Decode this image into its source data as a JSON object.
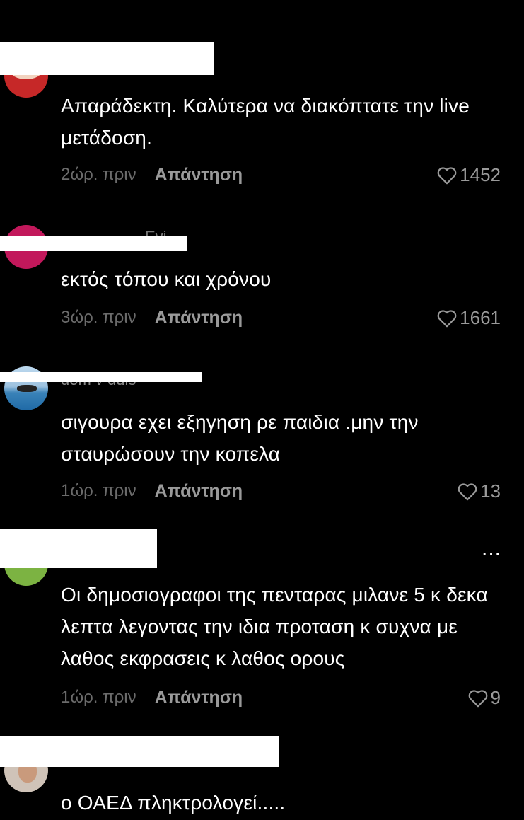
{
  "comments": [
    {
      "text": "Απαράδεκτη. Καλύτερα να διακόπτατε την live μετάδοση.",
      "time": "2ώρ. πριν",
      "reply": "Απάντηση",
      "likes": "1452"
    },
    {
      "username": "Evi",
      "text": "εκτός τόπου και χρόνου",
      "time": "3ώρ. πριν",
      "reply": "Απάντηση",
      "likes": "1661"
    },
    {
      "username": "dom v duls",
      "text": "σιγουρα εχει εξηγηση ρε παιδια .μην την σταυρώσουν την κοπελα",
      "time": "1ώρ. πριν",
      "reply": "Απάντηση",
      "likes": "13"
    },
    {
      "text": "Οι δημοσιογραφοι της πενταρας μιλανε 5 κ δεκα λεπτα λεγοντας την ιδια προταση κ συχνα με λαθος εκφρασεις κ λαθος ορους",
      "time": "1ώρ. πριν",
      "reply": "Απάντηση",
      "likes": "9",
      "more": "..."
    },
    {
      "text": "ο ΟΑΕΔ πληκτρολογεί....."
    }
  ],
  "colors": {
    "background": "#000000",
    "text": "#ffffff",
    "meta": "#6b6b6b",
    "reply": "#9a9a9a"
  },
  "icons": {
    "like": "heart-outline-icon",
    "more": "more-horizontal-icon"
  }
}
